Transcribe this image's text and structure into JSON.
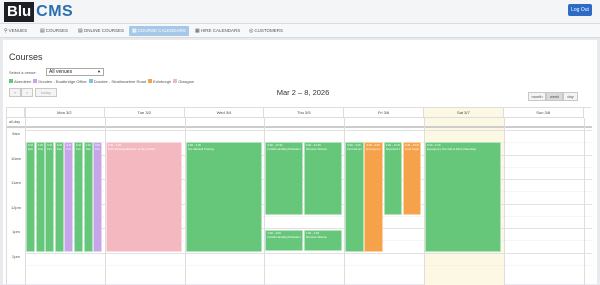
{
  "app": {
    "logo_box": "Blu",
    "logo_text": "CMS",
    "logout_label": "Log Out"
  },
  "nav": [
    {
      "icon": "⚲",
      "label": "VENUES",
      "active": false
    },
    {
      "icon": "▤",
      "label": "COURSES",
      "active": false
    },
    {
      "icon": "▤",
      "label": "ONLINE COURSES",
      "active": false
    },
    {
      "icon": "▦",
      "label": "COURSE CALENDARS",
      "active": true
    },
    {
      "icon": "▦",
      "label": "HIRE CALENDARS",
      "active": false
    },
    {
      "icon": "◎",
      "label": "CUSTOMERS",
      "active": false
    }
  ],
  "page": {
    "title": "Courses",
    "filter_label": "Select a venue:",
    "filter_value": "All venues"
  },
  "legend": [
    {
      "label": "Aberdeen",
      "color": "#66c67a"
    },
    {
      "label": "Dundee - Boatbridge Office",
      "color": "#c6a6e8"
    },
    {
      "label": "Dundee - Strathmartine Road",
      "color": "#7fc1e6"
    },
    {
      "label": "Edinburgh",
      "color": "#f6a24a"
    },
    {
      "label": "Glasgow",
      "color": "#f3b8c0"
    }
  ],
  "toolbar": {
    "prev": "‹",
    "next": "›",
    "today": "today",
    "range_title": "Mar 2 – 8, 2026",
    "views": [
      {
        "label": "month",
        "active": false
      },
      {
        "label": "week",
        "active": true
      },
      {
        "label": "day",
        "active": false
      }
    ]
  },
  "calendar": {
    "allday_label": "all-day",
    "days": [
      "Mon 3/2",
      "Tue 3/3",
      "Wed 3/4",
      "Thu 3/5",
      "Fri 3/6",
      "Sat 3/7",
      "Sun 3/8"
    ],
    "times": [
      "9am",
      "10am",
      "11am",
      "12pm",
      "1pm",
      "2pm"
    ],
    "today_index": 5
  },
  "events": [
    {
      "day": 0,
      "sub": 0,
      "subs": 8,
      "start": 9.5,
      "end": 14.0,
      "color": "#66c67a",
      "time": "9:30 - 4:30",
      "name": "Emergency First Aid at Work"
    },
    {
      "day": 0,
      "sub": 1,
      "subs": 8,
      "start": 9.5,
      "end": 14.0,
      "color": "#66c67a",
      "time": "9:30 - 4:30",
      "name": "First Aid at Work"
    },
    {
      "day": 0,
      "sub": 2,
      "subs": 8,
      "start": 9.5,
      "end": 14.0,
      "color": "#66c67a",
      "time": "9:30 - 4:30",
      "name": "First Aid Requalification"
    },
    {
      "day": 0,
      "sub": 3,
      "subs": 8,
      "start": 9.5,
      "end": 14.0,
      "color": "#66c67a",
      "time": "9:30 - 4:30",
      "name": "Paediatric First Aid"
    },
    {
      "day": 0,
      "sub": 4,
      "subs": 8,
      "start": 9.5,
      "end": 14.0,
      "color": "#c6a6e8",
      "time": "9:30 - 4:30",
      "name": "First Aid at Work"
    },
    {
      "day": 0,
      "sub": 5,
      "subs": 8,
      "start": 9.5,
      "end": 14.0,
      "color": "#66c67a",
      "time": "9:30 - 4:30",
      "name": "Food Hygiene"
    },
    {
      "day": 0,
      "sub": 6,
      "subs": 8,
      "start": 9.5,
      "end": 14.0,
      "color": "#66c67a",
      "time": "9:30 - 4:30",
      "name": "Manual Handling"
    },
    {
      "day": 0,
      "sub": 7,
      "subs": 8,
      "start": 9.5,
      "end": 14.0,
      "color": "#c6a6e8",
      "time": "9:30 - 4:30",
      "name": "Fire Safety"
    },
    {
      "day": 1,
      "sub": 0,
      "subs": 1,
      "start": 9.5,
      "end": 14.0,
      "color": "#f3b8c0",
      "time": "9:30 - 4:30",
      "name": "First Aid Requalification (3 day) (FAW)"
    },
    {
      "day": 2,
      "sub": 0,
      "subs": 1,
      "start": 9.5,
      "end": 14.0,
      "color": "#66c67a",
      "time": "9:30 - 4:30",
      "name": "Fire Marshal Training"
    },
    {
      "day": 3,
      "sub": 0,
      "subs": 2,
      "start": 9.5,
      "end": 12.5,
      "color": "#66c67a",
      "time": "9:30 - 12:30",
      "name": "Forklift Handling Refresher"
    },
    {
      "day": 3,
      "sub": 1,
      "subs": 2,
      "start": 9.5,
      "end": 12.5,
      "color": "#66c67a",
      "time": "9:30 - 12:30",
      "name": "Abrasive Wheels"
    },
    {
      "day": 3,
      "sub": 0,
      "subs": 2,
      "start": 13.1,
      "end": 14.0,
      "color": "#66c67a",
      "time": "1:00 - 4:00",
      "name": "Forklift Handling Refresher"
    },
    {
      "day": 3,
      "sub": 1,
      "subs": 2,
      "start": 13.1,
      "end": 14.0,
      "color": "#66c67a",
      "time": "1:00 - 4:00",
      "name": "Abrasive Wheels"
    },
    {
      "day": 4,
      "sub": 0,
      "subs": 4,
      "start": 9.5,
      "end": 14.0,
      "color": "#66c67a",
      "time": "9:30 - 4:30",
      "name": "First Aid at Work"
    },
    {
      "day": 4,
      "sub": 1,
      "subs": 4,
      "start": 9.5,
      "end": 14.0,
      "color": "#f6a24a",
      "time": "9:30 - 4:30",
      "name": "Emergency First Aid"
    },
    {
      "day": 4,
      "sub": 2,
      "subs": 4,
      "start": 9.5,
      "end": 12.5,
      "color": "#66c67a",
      "time": "9:30 - 12:30",
      "name": "Appointed Person"
    },
    {
      "day": 4,
      "sub": 3,
      "subs": 4,
      "start": 9.5,
      "end": 12.5,
      "color": "#f6a24a",
      "time": "9:30 - 12:30",
      "name": "Food Hygiene"
    },
    {
      "day": 5,
      "sub": 0,
      "subs": 1,
      "start": 9.5,
      "end": 14.0,
      "color": "#66c67a",
      "time": "9:30 - 4:30",
      "name": "Emergency First Aid at Work (Saturday)"
    }
  ]
}
